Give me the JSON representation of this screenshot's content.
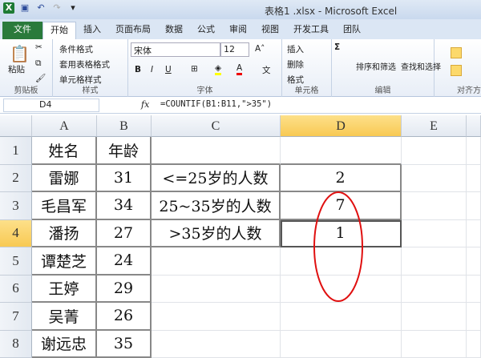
{
  "window": {
    "title": "表格1 .xlsx - Microsoft Excel"
  },
  "tabs": [
    "文件",
    "开始",
    "插入",
    "页面布局",
    "数据",
    "公式",
    "审阅",
    "视图",
    "开发工具",
    "团队"
  ],
  "ribbon": {
    "clipboard": {
      "paste": "粘贴",
      "label": "剪贴板"
    },
    "styles": {
      "items": [
        "条件格式",
        "套用表格格式",
        "单元格样式"
      ],
      "label": "样式"
    },
    "font": {
      "name": "宋体",
      "size": "12",
      "label": "字体",
      "bold": "B",
      "italic": "I",
      "underline": "U"
    },
    "cells": {
      "items": [
        "插入",
        "删除",
        "格式"
      ],
      "label": "单元格"
    },
    "editing": {
      "sort": "排序和筛选",
      "find": "查找和选择",
      "label": "编辑",
      "sum": "Σ"
    },
    "align": {
      "label": "对齐方"
    }
  },
  "formula_bar": {
    "name_box": "D4",
    "fx": "fx",
    "formula": "=COUNTIF(B1:B11,\">35\")"
  },
  "sheet": {
    "columns": [
      "A",
      "B",
      "C",
      "D",
      "E"
    ],
    "selected_cell": "D4",
    "rows": [
      {
        "n": "1",
        "A": "姓名",
        "B": "年龄",
        "C": "",
        "D": ""
      },
      {
        "n": "2",
        "A": "雷娜",
        "B": "31",
        "C": "<=25岁的人数",
        "D": "2"
      },
      {
        "n": "3",
        "A": "毛昌军",
        "B": "34",
        "C": "25~35岁的人数",
        "D": "7"
      },
      {
        "n": "4",
        "A": "潘扬",
        "B": "27",
        "C": ">35岁的人数",
        "D": "1"
      },
      {
        "n": "5",
        "A": "谭楚芝",
        "B": "24",
        "C": "",
        "D": ""
      },
      {
        "n": "6",
        "A": "王婷",
        "B": "29",
        "C": "",
        "D": ""
      },
      {
        "n": "7",
        "A": "吴菁",
        "B": "26",
        "C": "",
        "D": ""
      },
      {
        "n": "8",
        "A": "谢远忠",
        "B": "35",
        "C": "",
        "D": ""
      }
    ]
  },
  "annotation_color": "#e01010"
}
